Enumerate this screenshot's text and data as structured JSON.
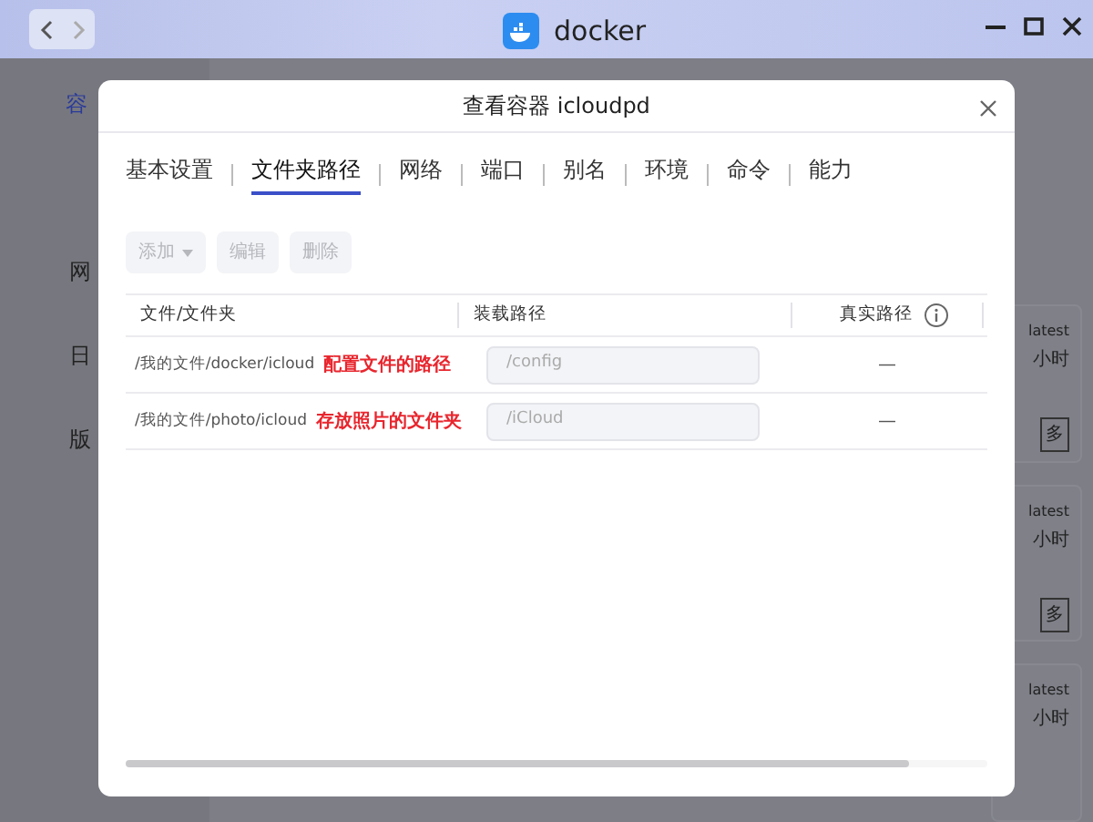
{
  "window": {
    "title": "docker"
  },
  "sidebar": {
    "items": [
      {
        "label": "容",
        "selected": true
      },
      {
        "label": "网",
        "selected": false
      },
      {
        "label": "日",
        "selected": false
      },
      {
        "label": "版",
        "selected": false
      }
    ]
  },
  "cards": [
    {
      "tag": "latest",
      "time": "小时",
      "button": "多"
    },
    {
      "tag": "latest",
      "time": "小时",
      "button": "多"
    },
    {
      "tag": "latest",
      "time": "小时"
    }
  ],
  "dialog": {
    "title": "查看容器 icloudpd",
    "tabs": [
      {
        "label": "基本设置",
        "selected": false
      },
      {
        "label": "文件夹路径",
        "selected": true
      },
      {
        "label": "网络",
        "selected": false
      },
      {
        "label": "端口",
        "selected": false
      },
      {
        "label": "别名",
        "selected": false
      },
      {
        "label": "环境",
        "selected": false
      },
      {
        "label": "命令",
        "selected": false
      },
      {
        "label": "能力",
        "selected": false
      }
    ],
    "toolbar": [
      {
        "label": "添加",
        "dropdown": true,
        "disabled": true
      },
      {
        "label": "编辑",
        "dropdown": false,
        "disabled": true
      },
      {
        "label": "删除",
        "dropdown": false,
        "disabled": true
      }
    ],
    "table": {
      "columns": [
        "文件/文件夹",
        "装载路径",
        "真实路径"
      ],
      "rows": [
        {
          "file": "/我的文件/docker/icloud",
          "note": "配置文件的路径",
          "mount": "/config",
          "real": "—"
        },
        {
          "file": "/我的文件/photo/icloud",
          "note": "存放照片的文件夹",
          "mount": "/iCloud",
          "real": "—"
        }
      ]
    }
  }
}
